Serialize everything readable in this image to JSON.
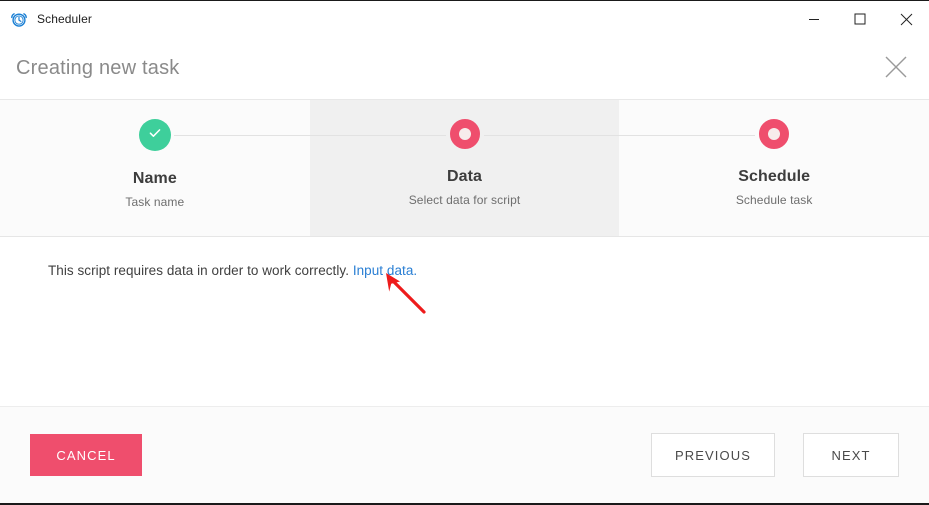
{
  "titlebar": {
    "app_title": "Scheduler",
    "icon": "alarm-clock-icon",
    "icon_color": "#1a7fd4",
    "minimize_label": "Minimize",
    "maximize_label": "Maximize",
    "close_label": "Close"
  },
  "header": {
    "title": "Creating new task",
    "close_label": "Close dialog",
    "close_icon": "close-icon"
  },
  "stepper": {
    "steps": [
      {
        "label": "Name",
        "sublabel": "Task name",
        "state": "completed",
        "icon": "check-icon",
        "color": "#3ecf9b"
      },
      {
        "label": "Data",
        "sublabel": "Select data for script",
        "state": "active",
        "icon": "dot-icon",
        "color": "#ef4e6d"
      },
      {
        "label": "Schedule",
        "sublabel": "Schedule task",
        "state": "upcoming",
        "icon": "dot-icon",
        "color": "#ef4e6d"
      }
    ]
  },
  "content": {
    "message": "This script requires data in order to work correctly.",
    "link_text": "Input data",
    "message_suffix": ".",
    "annotation": {
      "type": "arrow",
      "color": "#ee1b1b",
      "points_to": "Input data"
    }
  },
  "footer": {
    "cancel_label": "CANCEL",
    "previous_label": "PREVIOUS",
    "next_label": "NEXT"
  },
  "colors": {
    "accent_pink": "#ef4e6d",
    "success_green": "#3ecf9b",
    "link_blue": "#2a7fd4",
    "annotation_red": "#ee1b1b"
  }
}
